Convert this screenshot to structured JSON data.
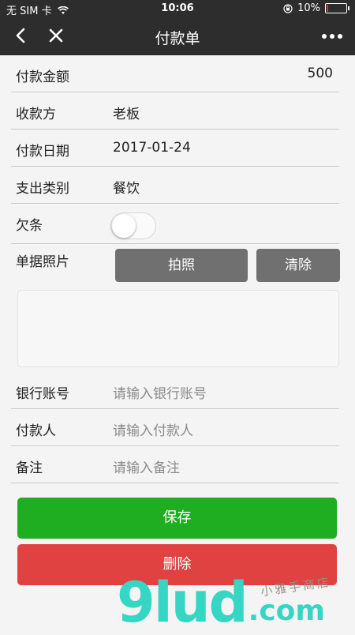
{
  "status_bar": {
    "carrier": "无 SIM 卡",
    "time": "10:06",
    "battery": "10%",
    "battery_level": 0.1
  },
  "nav": {
    "title": "付款单",
    "back_icon": "chevron-left-icon",
    "close_icon": "close-icon",
    "more_icon": "more-horizontal-icon"
  },
  "form": {
    "amount": {
      "label": "付款金额",
      "value": "500"
    },
    "payee": {
      "label": "收款方",
      "value": "老板"
    },
    "date": {
      "label": "付款日期",
      "value": "2017-01-24"
    },
    "category": {
      "label": "支出类别",
      "value": "餐饮"
    },
    "iou": {
      "label": "欠条",
      "on": false
    },
    "photo": {
      "label": "单据照片",
      "take_photo": "拍照",
      "clear": "清除"
    },
    "bank_account": {
      "label": "银行账号",
      "placeholder": "请输入银行账号"
    },
    "payer": {
      "label": "付款人",
      "placeholder": "请输入付款人"
    },
    "note": {
      "label": "备注",
      "placeholder": "请输入备注"
    }
  },
  "actions": {
    "save": "保存",
    "delete": "删除"
  },
  "watermark": {
    "logo": "9lud",
    "domain": ".com",
    "tagline": "小雅手商店"
  },
  "colors": {
    "bar_bg": "#2d2d2d",
    "save_green": "#1fad21",
    "delete_red": "#e04141",
    "photo_button_gray": "#707070",
    "watermark_teal": "#35d6c4"
  }
}
